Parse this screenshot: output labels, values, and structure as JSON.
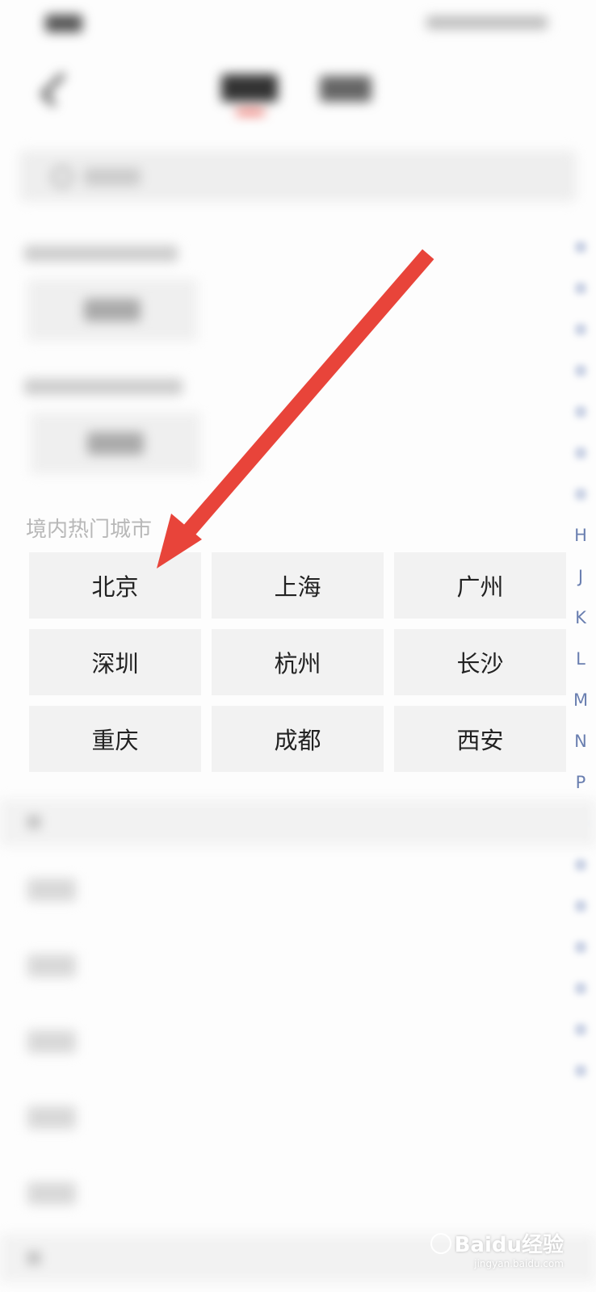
{
  "hot_cities": {
    "title": "境内热门城市",
    "cities": [
      "北京",
      "上海",
      "广州",
      "深圳",
      "杭州",
      "长沙",
      "重庆",
      "成都",
      "西安"
    ]
  },
  "alphabet_index": [
    "H",
    "J",
    "K",
    "L",
    "M",
    "N",
    "P"
  ],
  "watermark": {
    "brand": "Baidu经验",
    "url": "jingyan.baidu.com"
  },
  "colors": {
    "arrow": "#e8443a",
    "index_letter": "#6a7fb0",
    "tab_underline": "#e8443a"
  }
}
